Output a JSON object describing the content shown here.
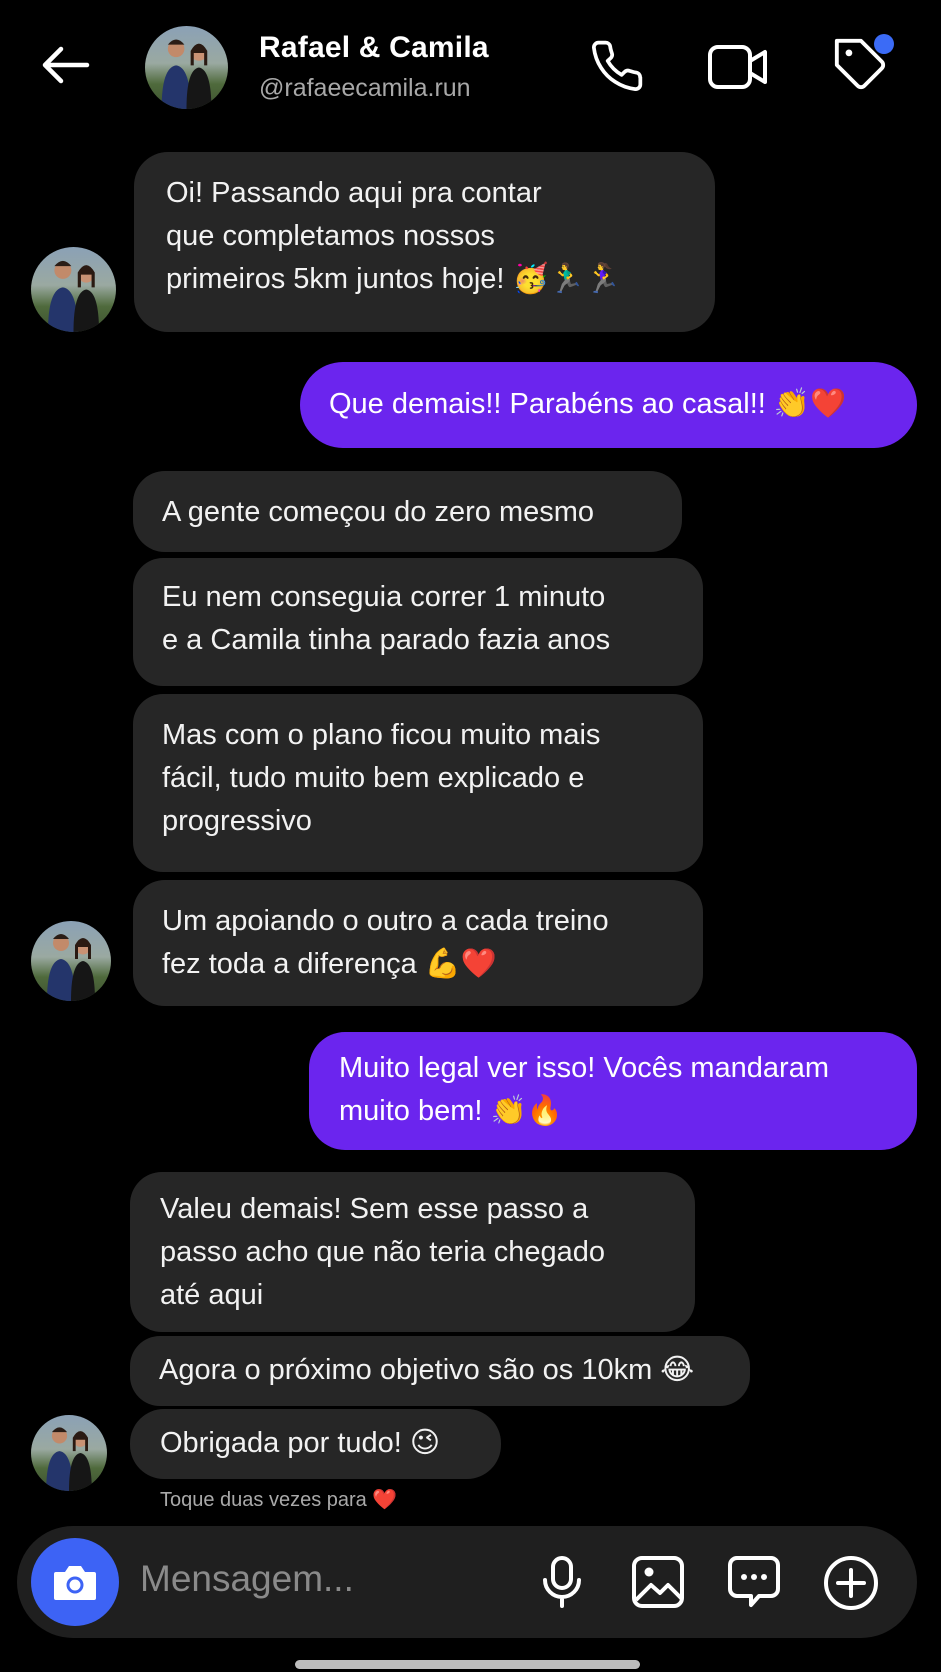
{
  "header": {
    "title": "Rafael & Camila",
    "handle": "@rafaeecamila.run"
  },
  "messages": [
    {
      "id": "m1",
      "side": "in",
      "text": "Oi! Passando aqui pra contar\nque completamos nossos\nprimeiros 5km juntos hoje! 🥳🏃‍♂️🏃‍♀️"
    },
    {
      "id": "m2",
      "side": "out",
      "text": "Que demais!! Parabéns ao casal!! 👏❤️"
    },
    {
      "id": "m3",
      "side": "in",
      "text": "A gente começou do zero mesmo"
    },
    {
      "id": "m4",
      "side": "in",
      "text": "Eu nem conseguia correr 1 minuto\ne a Camila tinha parado fazia anos"
    },
    {
      "id": "m5",
      "side": "in",
      "text": "Mas com o plano ficou muito mais\nfácil, tudo muito bem explicado e\nprogressivo"
    },
    {
      "id": "m6",
      "side": "in",
      "text": "Um apoiando o outro a cada treino\nfez toda a diferença 💪❤️"
    },
    {
      "id": "m7",
      "side": "out",
      "text": "Muito legal ver isso! Vocês mandaram\nmuito bem! 👏🔥"
    },
    {
      "id": "m8",
      "side": "in",
      "text": "Valeu demais! Sem esse passo a\npasso acho que não teria chegado\naté aqui"
    },
    {
      "id": "m9",
      "side": "in",
      "text": "Agora o próximo objetivo são os 10km 😂"
    },
    {
      "id": "m10",
      "side": "in",
      "text": "Obrigada por tudo! 😉"
    }
  ],
  "hint": {
    "text": "Toque duas vezes para",
    "heart": "❤️"
  },
  "composer": {
    "placeholder": "Mensagem..."
  },
  "icons": {
    "back": "arrow-left-icon",
    "call": "phone-icon",
    "video": "video-camera-icon",
    "tag": "tag-icon",
    "camera": "camera-icon",
    "mic": "microphone-icon",
    "gallery": "image-icon",
    "sticker": "chat-bubble-dots-icon",
    "more": "plus-circle-icon"
  },
  "colors": {
    "outgoing_bubble": "#6b25ee",
    "incoming_bubble": "#262626",
    "camera_button": "#3d63f5",
    "badge": "#3b6bf6"
  }
}
